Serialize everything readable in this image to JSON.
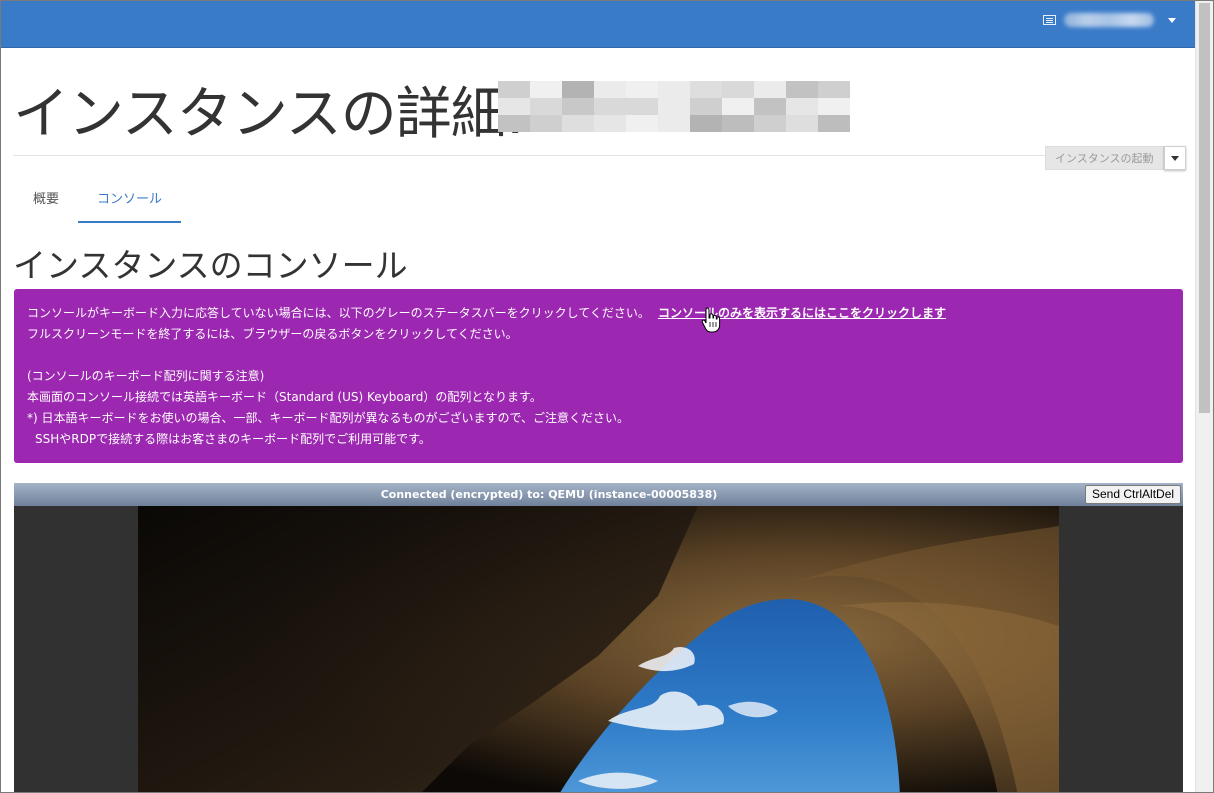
{
  "header": {
    "user_menu_icon": "user-menu-icon"
  },
  "page": {
    "title": "インスタンスの詳細:",
    "launch_button_label": "インスタンスの起動"
  },
  "tabs": [
    {
      "label": "概要",
      "active": false
    },
    {
      "label": "コンソール",
      "active": true
    }
  ],
  "console_section": {
    "title": "インスタンスのコンソール",
    "notice": {
      "line1": "コンソールがキーボード入力に応答していない場合には、以下のグレーのステータスバーをクリックしてください。",
      "line1_link": "コンソールのみを表示するにはここをクリックします",
      "line2": "フルスクリーンモードを終了するには、ブラウザーの戻るボタンをクリックしてください。",
      "line3": "(コンソールのキーボード配列に関する注意)",
      "line4": "本画面のコンソール接続では英語キーボード（Standard (US) Keyboard）の配列となります。",
      "line5": "*) 日本語キーボードをお使いの場合、一部、キーボード配列が異なるものがございますので、ご注意ください。",
      "line6": "SSHやRDPで接続する際はお客さまのキーボード配列でご利用可能です。"
    }
  },
  "console": {
    "status": "Connected (encrypted) to: QEMU (instance-00005838)",
    "send_cad_label": "Send CtrlAltDel"
  },
  "colors": {
    "topbar": "#3a7bc8",
    "notice_bg": "#9c27b0",
    "link": "#3a7bc8"
  }
}
